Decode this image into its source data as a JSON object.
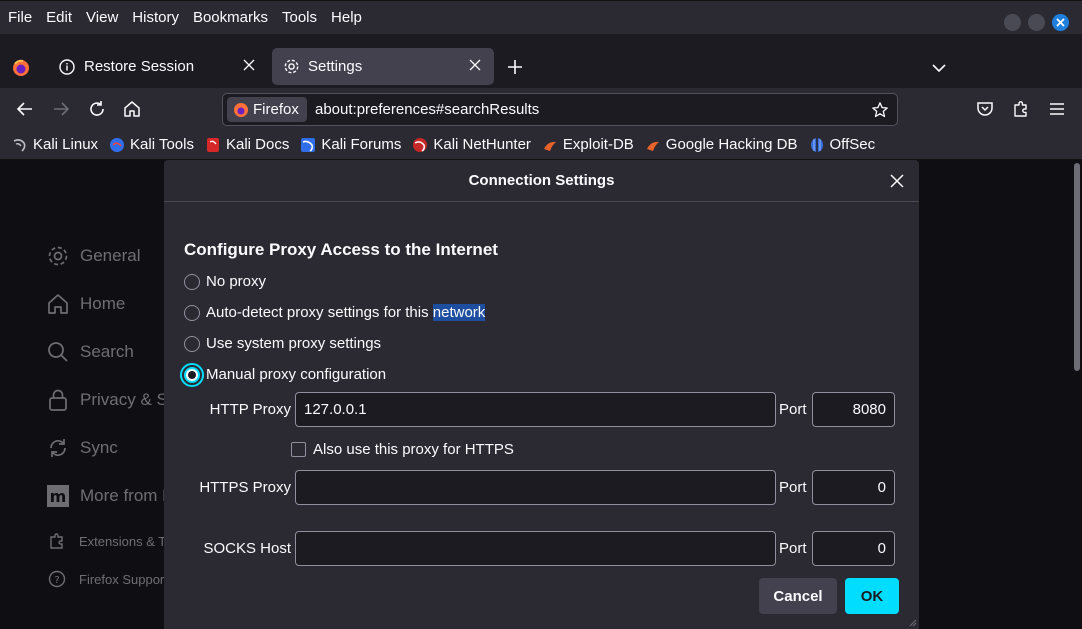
{
  "menu": [
    "File",
    "Edit",
    "View",
    "History",
    "Bookmarks",
    "Tools",
    "Help"
  ],
  "tabs": {
    "inactive_label": "Restore Session",
    "active_label": "Settings"
  },
  "urlbar": {
    "identity_label": "Firefox",
    "url": "about:preferences#searchResults"
  },
  "bookmarks": [
    "Kali Linux",
    "Kali Tools",
    "Kali Docs",
    "Kali Forums",
    "Kali NetHunter",
    "Exploit-DB",
    "Google Hacking DB",
    "OffSec"
  ],
  "sidebar": {
    "general": "General",
    "home": "Home",
    "search": "Search",
    "privacy": "Privacy & Se",
    "sync": "Sync",
    "more": "More from M",
    "extensions": "Extensions & T",
    "support": "Firefox Suppor"
  },
  "dialog": {
    "title": "Connection Settings",
    "section_title": "Configure Proxy Access to the Internet",
    "options": {
      "no_proxy": "No proxy",
      "auto_detect_prefix": "Auto-detect proxy settings for this ",
      "auto_detect_highlight": "network",
      "system": "Use system proxy settings",
      "manual": "Manual proxy configuration"
    },
    "selected_option": "manual",
    "http_proxy_label": "HTTP Proxy",
    "http_proxy_value": "127.0.0.1",
    "http_port_label": "Port",
    "http_port_value": "8080",
    "also_https_label": "Also use this proxy for HTTPS",
    "also_https_checked": false,
    "https_proxy_label": "HTTPS Proxy",
    "https_proxy_value": "",
    "https_port_label": "Port",
    "https_port_value": "0",
    "socks_host_label": "SOCKS Host",
    "socks_host_value": "",
    "socks_port_label": "Port",
    "socks_port_value": "0",
    "cancel_label": "Cancel",
    "ok_label": "OK"
  },
  "colors": {
    "accent": "#00ddff",
    "dialog_bg": "#2b2a33",
    "page_bg": "#1c1b22",
    "selection": "#1d4e9f"
  }
}
